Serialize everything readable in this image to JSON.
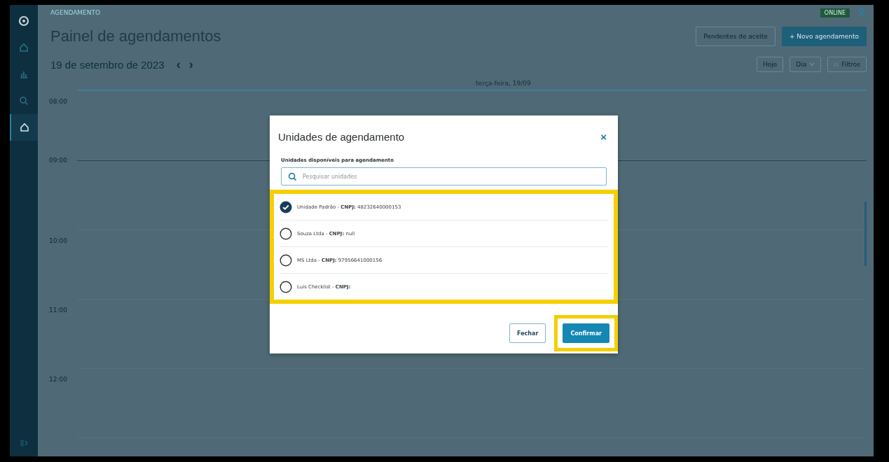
{
  "sidebar": {
    "items": [
      {
        "kind": "logo",
        "selected": false
      },
      {
        "kind": "home",
        "selected": false
      },
      {
        "kind": "chart",
        "selected": false
      },
      {
        "kind": "search",
        "selected": false
      },
      {
        "kind": "home",
        "selected": true
      },
      {
        "kind": "expand",
        "selected": false
      }
    ]
  },
  "breadcrumb": "AGENDAMENTO",
  "status_badge": "ONLINE",
  "title": "Painel de agendamentos",
  "header_buttons": [
    {
      "label": "Pendentes de aceite",
      "kind": "outline"
    },
    {
      "label": "+ Novo agendamento",
      "kind": "primary"
    }
  ],
  "date": "19 de setembro de 2023",
  "date_nav": [
    "‹",
    "›"
  ],
  "view_buttons": [
    {
      "label": "Hoje",
      "kind": "plain"
    },
    {
      "label": "Dia",
      "kind": "dropdown"
    },
    {
      "label": "Filtros",
      "kind": "filter"
    }
  ],
  "calendar": {
    "day_header": "terça-feira, 19/09",
    "times": [
      "08:00",
      "09:00",
      "10:00",
      "11:00",
      "12:00"
    ]
  },
  "modal": {
    "title": "Unidades de agendamento",
    "close": "×",
    "section_label": "Unidades disponíveis para agendamento",
    "search": {
      "placeholder": "Pesquisar unidades"
    },
    "list_highlighted": true,
    "units": [
      {
        "text": "Unidade Padrão - **CNPJ:** 48232640000153",
        "selected": true
      },
      {
        "text": "Souza Ltda - **CNPJ:** null",
        "selected": false
      },
      {
        "text": "MS Ltda - **CNPJ:** 97956641000156",
        "selected": false
      },
      {
        "text": "Luis Checklist - **CNPJ:**",
        "selected": false
      }
    ],
    "buttons": [
      {
        "label": "Fechar",
        "kind": "secondary",
        "highlighted": false
      },
      {
        "label": "Confirmar",
        "kind": "primary",
        "highlighted": true
      }
    ]
  }
}
